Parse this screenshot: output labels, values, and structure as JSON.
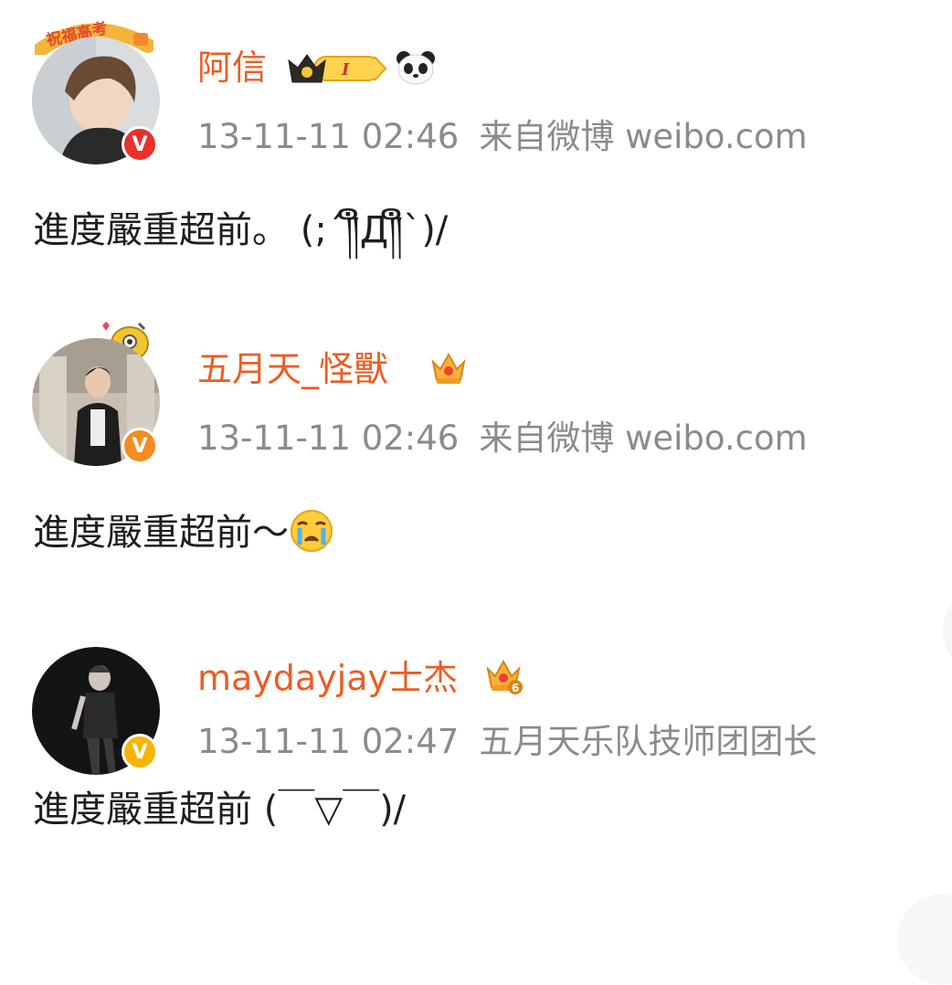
{
  "posts": [
    {
      "username": "阿信",
      "time": "13-11-11 02:46",
      "source": "来自微博 weibo.com",
      "content": "進度嚴重超前。 (;´༎ຶД༎ຶ`)/",
      "pendant_text": "祝福高考",
      "level_badge": "I",
      "verify_color": "#e8312a"
    },
    {
      "username": "五月天_怪獸",
      "time": "13-11-11 02:46",
      "source": "来自微博 weibo.com",
      "content": "進度嚴重超前～",
      "verify_color": "#f58b1f"
    },
    {
      "username": "maydayjay士杰",
      "time": "13-11-11 02:47",
      "source": "五月天乐队技师团团长",
      "content": "進度嚴重超前 (￣▽￣)/",
      "crown_level": "6",
      "verify_color": "#f7b500"
    }
  ],
  "colors": {
    "username": "#eb5d23",
    "meta": "#8b8b8b",
    "content": "#1e1e1e"
  }
}
